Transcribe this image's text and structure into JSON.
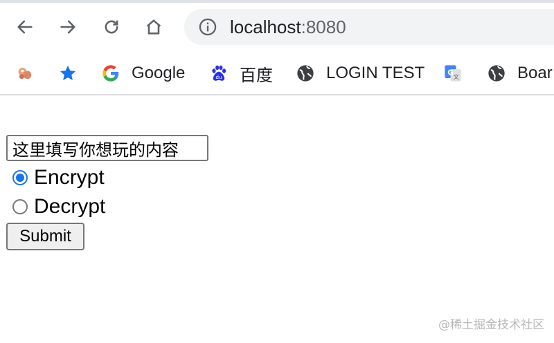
{
  "browser": {
    "address_host": "localhost",
    "address_port": ":8080",
    "nav_icons": [
      "back-icon",
      "forward-icon",
      "reload-icon",
      "home-icon"
    ],
    "bookmarks": [
      {
        "icon": "extension-icon",
        "label": ""
      },
      {
        "icon": "star-icon",
        "label": ""
      },
      {
        "icon": "google-icon",
        "label": "Google"
      },
      {
        "icon": "baidu-icon",
        "label": "百度"
      },
      {
        "icon": "globe-icon",
        "label": "LOGIN TEST"
      },
      {
        "icon": "translate-icon",
        "label": ""
      },
      {
        "icon": "globe-icon",
        "label": "Boar"
      }
    ]
  },
  "form": {
    "text_value": "这里填写你想玩的内容",
    "options": [
      {
        "label": "Encrypt",
        "checked": true
      },
      {
        "label": "Decrypt",
        "checked": false
      }
    ],
    "submit_label": "Submit"
  },
  "watermark": "@稀土掘金技术社区",
  "colors": {
    "accent": "#1a73e8",
    "star": "#1a73e8",
    "omnibox_bg": "#f1f3f4"
  }
}
